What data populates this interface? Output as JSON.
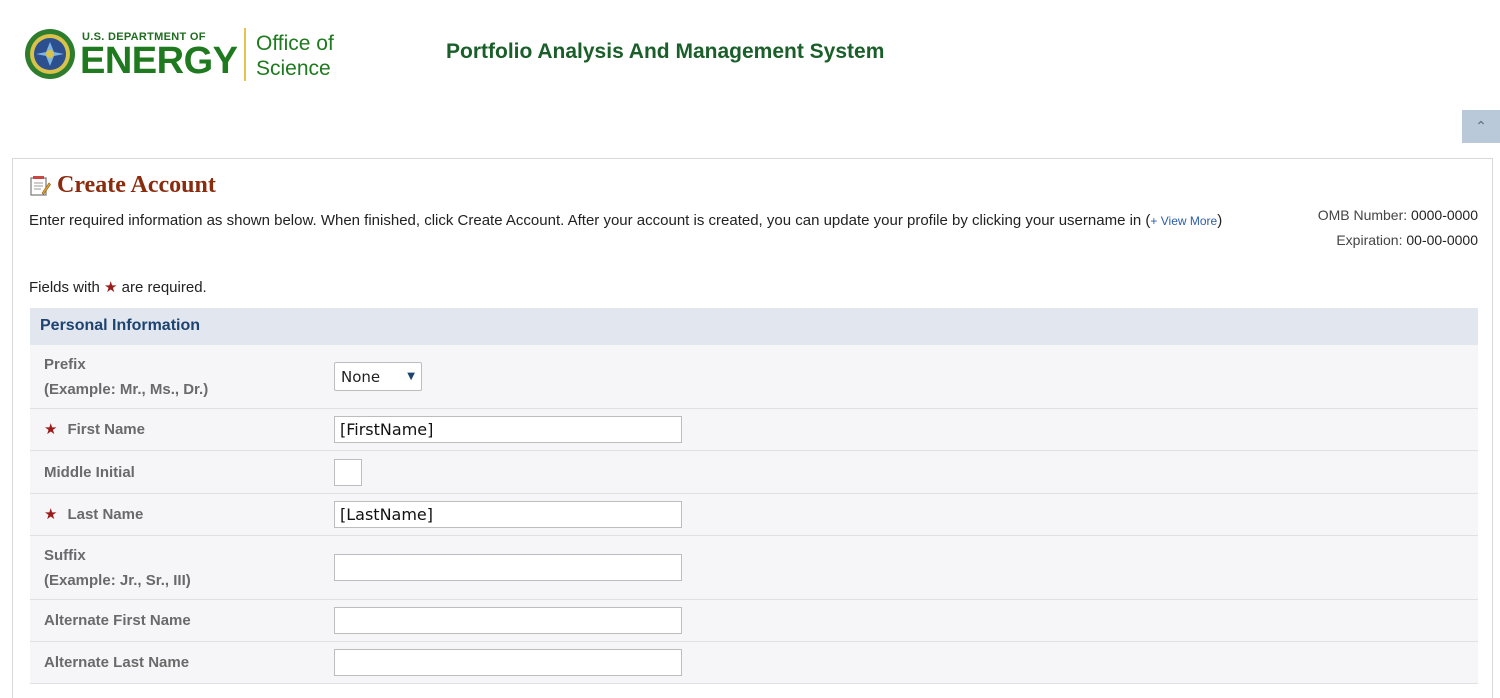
{
  "header": {
    "doe_small": "U.S. DEPARTMENT OF",
    "doe_big": "ENERGY",
    "office_line1": "Office of",
    "office_line2": "Science",
    "system_title": "Portfolio Analysis And Management System"
  },
  "page": {
    "title": "Create Account",
    "intro": "Enter required information as shown below. When finished, click Create Account. After your account is created, you can update your profile by clicking your username in (",
    "view_more": "+ View More",
    "intro_close": ")",
    "required_prefix": "Fields with",
    "required_suffix": "are required.",
    "omb_label": "OMB Number:",
    "omb_value": "0000-0000",
    "expiration_label": "Expiration:",
    "expiration_value": "00-00-0000"
  },
  "section": {
    "title": "Personal Information"
  },
  "fields": {
    "prefix": {
      "label": "Prefix",
      "hint": "(Example: Mr., Ms., Dr.)",
      "value": "None"
    },
    "first_name": {
      "label": "First Name",
      "value": "[FirstName]"
    },
    "middle_initial": {
      "label": "Middle Initial",
      "value": ""
    },
    "last_name": {
      "label": "Last Name",
      "value": "[LastName]"
    },
    "suffix": {
      "label": "Suffix",
      "hint": "(Example: Jr., Sr., III)",
      "value": ""
    },
    "alt_first": {
      "label": "Alternate First Name",
      "value": ""
    },
    "alt_last": {
      "label": "Alternate Last Name",
      "value": ""
    }
  },
  "colors": {
    "title": "#8b2b0e",
    "header_green": "#1f7a1f",
    "section_bg": "#e2e6ee",
    "required_star": "#9b1b1b"
  },
  "icons": {
    "seal": "doe-seal-icon",
    "form": "form-edit-icon",
    "collapse": "double-chevron-up-icon"
  }
}
